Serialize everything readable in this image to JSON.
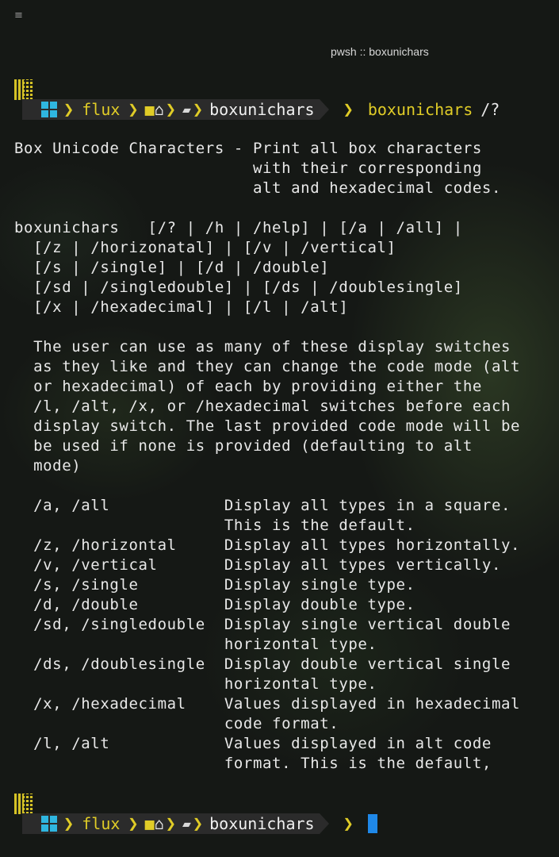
{
  "window": {
    "title": "pwsh :: boxunichars",
    "menu_icon": "≡"
  },
  "prompt": {
    "user": "flux",
    "folder": "boxunichars",
    "command": "boxunichars",
    "argument": "/?"
  },
  "output": {
    "lines": [
      "Box Unicode Characters - Print all box characters",
      "                         with their corresponding",
      "                         alt and hexadecimal codes.",
      "",
      "boxunichars   [/? | /h | /help] | [/a | /all] |",
      "  [/z | /horizonatal] | [/v | /vertical]",
      "  [/s | /single] | [/d | /double]",
      "  [/sd | /singledouble] | [/ds | /doublesingle]",
      "  [/x | /hexadecimal] | [/l | /alt]",
      "",
      "  The user can use as many of these display switches",
      "  as they like and they can change the code mode (alt",
      "  or hexadecimal) of each by providing either the",
      "  /l, /alt, /x, or /hexadecimal switches before each",
      "  display switch. The last provided code mode will be",
      "  be used if none is provided (defaulting to alt",
      "  mode)",
      "",
      "  /a, /all            Display all types in a square.",
      "                      This is the default.",
      "  /z, /horizontal     Display all types horizontally.",
      "  /v, /vertical       Display all types vertically.",
      "  /s, /single         Display single type.",
      "  /d, /double         Display double type.",
      "  /sd, /singledouble  Display single vertical double",
      "                      horizontal type.",
      "  /ds, /doublesingle  Display double vertical single",
      "                      horizontal type.",
      "  /x, /hexadecimal    Values displayed in hexadecimal",
      "                      code format.",
      "  /l, /alt            Values displayed in alt code",
      "                      format. This is the default,"
    ]
  },
  "colors": {
    "accent_yellow": "#e0cc27",
    "segment_bg": "#2b2b2b",
    "cursor": "#1f88e8",
    "windows_logo": "#2fb6e0"
  },
  "icons": {
    "windows": "windows-icon",
    "folder": "folder-icon",
    "home": "home-icon",
    "open_folder": "open-folder-icon"
  }
}
